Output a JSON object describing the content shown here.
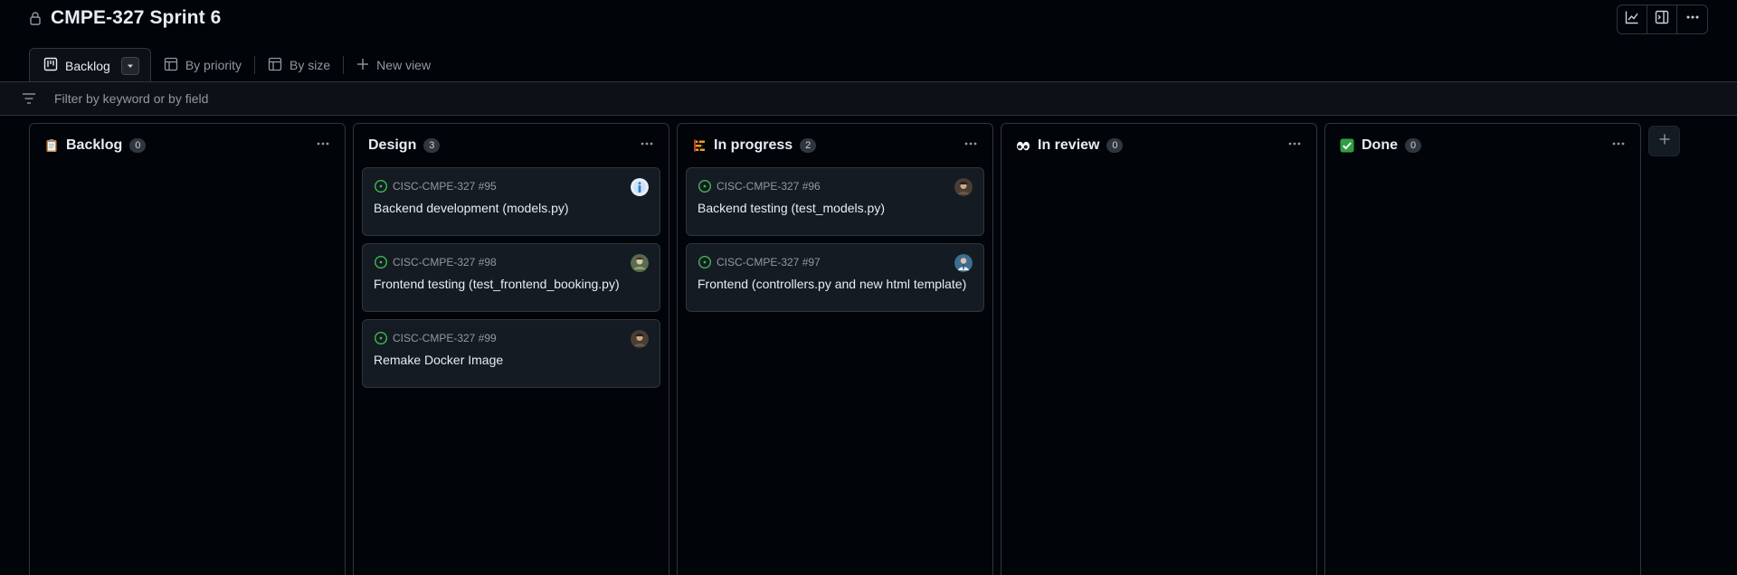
{
  "project": {
    "title": "CMPE-327 Sprint 6"
  },
  "top_actions": [
    {
      "name": "insights-button",
      "icon": "graph-icon"
    },
    {
      "name": "layout-panel-button",
      "icon": "sidebar-expand-icon"
    },
    {
      "name": "more-options-button",
      "icon": "kebab-horizontal-icon"
    }
  ],
  "tabs": [
    {
      "label": "Backlog",
      "icon": "board-icon",
      "active": true
    },
    {
      "label": "By priority",
      "icon": "table-icon"
    },
    {
      "label": "By size",
      "icon": "table-icon"
    },
    {
      "label": "New view",
      "icon": "plus-icon"
    }
  ],
  "filter": {
    "placeholder": "Filter by keyword or by field",
    "value": ""
  },
  "columns": [
    {
      "name": "Backlog",
      "count": "0",
      "emoji": "clipboard",
      "cards": []
    },
    {
      "name": "Design",
      "count": "3",
      "emoji": "none",
      "cards": [
        {
          "ref": "CISC-CMPE-327 #95",
          "title": "Backend development (models.py)",
          "avatar": "avatar-blue"
        },
        {
          "ref": "CISC-CMPE-327 #98",
          "title": "Frontend testing (test_frontend_booking.py)",
          "avatar": "avatar-green"
        },
        {
          "ref": "CISC-CMPE-327 #99",
          "title": "Remake Docker Image",
          "avatar": "avatar-brown"
        }
      ]
    },
    {
      "name": "In progress",
      "count": "2",
      "emoji": "construction",
      "cards": [
        {
          "ref": "CISC-CMPE-327 #96",
          "title": "Backend testing (test_models.py)",
          "avatar": "avatar-brown"
        },
        {
          "ref": "CISC-CMPE-327 #97",
          "title": "Frontend (controllers.py and new html template)",
          "avatar": "avatar-person"
        }
      ]
    },
    {
      "name": "In review",
      "count": "0",
      "emoji": "eyes",
      "cards": []
    },
    {
      "name": "Done",
      "count": "0",
      "emoji": "check-box",
      "cards": []
    }
  ],
  "colors": {
    "background": "#010409",
    "card_bg": "#151b23",
    "border": "#30363d",
    "open_issue": "#3fb950",
    "text_primary": "#e6edf3",
    "text_muted": "#9198a1"
  }
}
